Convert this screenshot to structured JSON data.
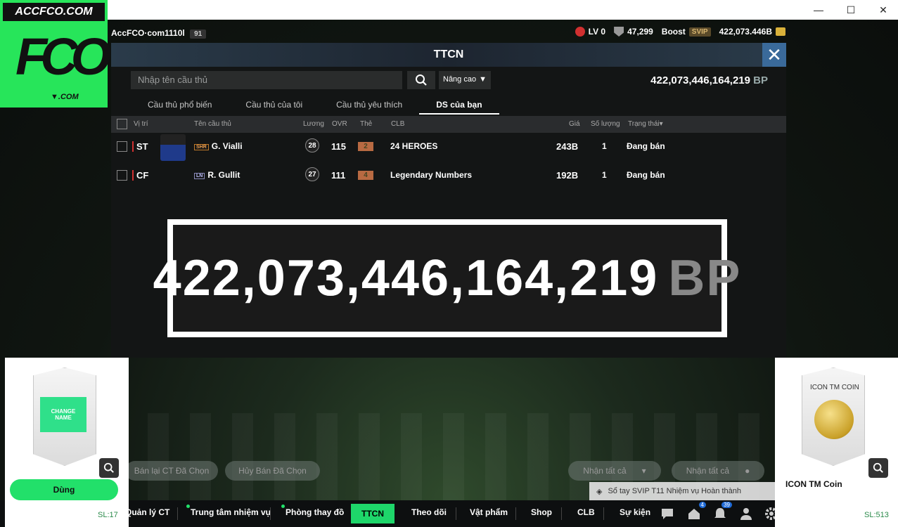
{
  "window": {
    "minimize": "—",
    "maximize": "☐",
    "close": "✕"
  },
  "logo": {
    "brand": "ACCFCO.COM",
    "mark": "FCO",
    "sub": "▼.COM"
  },
  "hud": {
    "account": "AccFCO·com1110l",
    "level_badge": "91",
    "lv": "LV 0",
    "points": "47,299",
    "boost": "Boost",
    "svip": "SVIP",
    "balance_short": "422,073.446B"
  },
  "panel": {
    "title": "TTCN",
    "search_placeholder": "Nhập tên cầu thủ",
    "advanced": "Nâng cao",
    "balance_value": "422,073,446,164,219",
    "balance_unit": "BP",
    "tabs": [
      "Cầu thủ phổ biến",
      "Cầu thủ của tôi",
      "Cầu thủ yêu thích",
      "DS của bạn"
    ],
    "columns": {
      "pos": "Vị trí",
      "name": "Tên cầu thủ",
      "wage": "Lương",
      "ovr": "OVR",
      "card": "Thẻ",
      "club": "CLB",
      "price": "Giá",
      "qty": "Số lượng",
      "status": "Trạng thái▾"
    },
    "rows": [
      {
        "pos": "ST",
        "season": "SHR",
        "name": "G. Vialli",
        "wage": "28",
        "ovr": "115",
        "grade": "2",
        "club": "24 HEROES",
        "price": "243B",
        "qty": "1",
        "status": "Đang bán"
      },
      {
        "pos": "CF",
        "season": "LN",
        "name": "R. Gullit",
        "wage": "27",
        "ovr": "111",
        "grade": "4",
        "club": "Legendary Numbers",
        "price": "192B",
        "qty": "1",
        "status": "Đang bán"
      }
    ]
  },
  "zoom": {
    "value": "422,073,446,164,219",
    "unit": "BP"
  },
  "actions": {
    "resell": "Bán lại CT Đã Chọn",
    "cancel": "Hủy Bán Đã Chọn",
    "claim_all_1": "Nhận tất cả",
    "claim_all_2": "Nhận tất cả"
  },
  "notice": "Sổ tay SVIP T11 Nhiệm vụ Hoàn thành",
  "nav": {
    "items": [
      "Quản lý CT",
      "Trung tâm nhiệm vụ",
      "Phòng thay đồ",
      "TTCN",
      "Theo dõi",
      "Vật phẩm",
      "Shop",
      "CLB",
      "Sự kiện"
    ],
    "badge_1": "4",
    "badge_2": "39"
  },
  "left_card": {
    "card_text": "CHANGE NAME",
    "use": "Dùng",
    "sl": "SL:17"
  },
  "right_card": {
    "card_title": "ICON TM COIN",
    "name": "ICON TM Coin",
    "sl": "SL:513"
  }
}
